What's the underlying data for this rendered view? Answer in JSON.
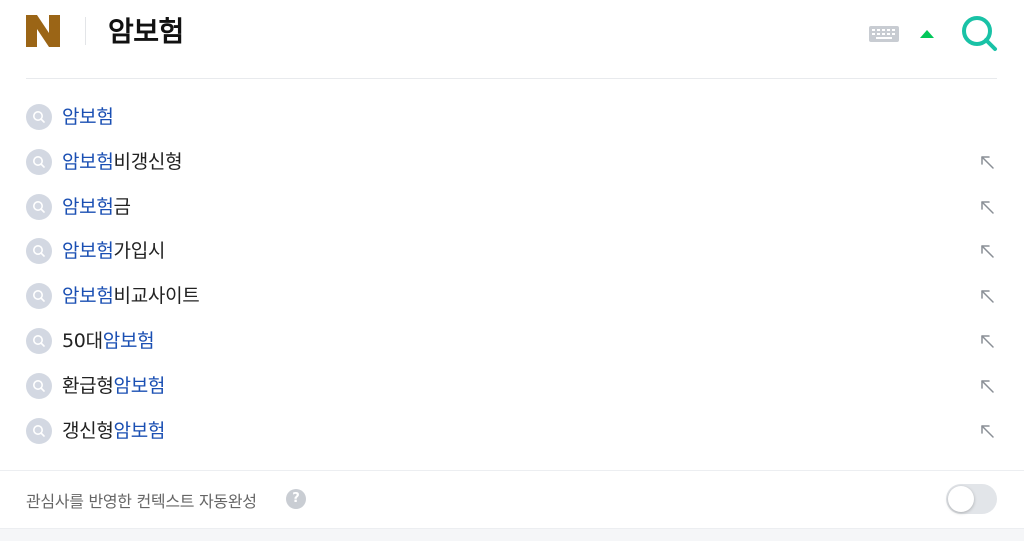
{
  "header": {
    "logo_letter": "N",
    "query": "암보험"
  },
  "suggestions": [
    {
      "prefix": "",
      "highlight": "암보험",
      "suffix": "",
      "has_fill_icon": false
    },
    {
      "prefix": "",
      "highlight": "암보험",
      "suffix": "비갱신형",
      "has_fill_icon": true
    },
    {
      "prefix": "",
      "highlight": "암보험",
      "suffix": "금",
      "has_fill_icon": true
    },
    {
      "prefix": "",
      "highlight": "암보험",
      "suffix": "가입시",
      "has_fill_icon": true
    },
    {
      "prefix": "",
      "highlight": "암보험",
      "suffix": "비교사이트",
      "has_fill_icon": true
    },
    {
      "prefix": "50대",
      "highlight": "암보험",
      "suffix": "",
      "has_fill_icon": true
    },
    {
      "prefix": "환급형",
      "highlight": "암보험",
      "suffix": "",
      "has_fill_icon": true
    },
    {
      "prefix": "갱신형",
      "highlight": "암보험",
      "suffix": "",
      "has_fill_icon": true
    }
  ],
  "footer": {
    "label": "관심사를 반영한 컨텍스트 자동완성",
    "help_glyph": "?",
    "toggle_on": false
  },
  "colors": {
    "logo": "#9b6516",
    "highlight": "#1a4fb3",
    "accent_green": "#03c75a",
    "search_teal": "#19c2a6"
  },
  "icons": {
    "keyboard": "keyboard-icon",
    "collapse": "arrow-up-icon",
    "search": "search-icon",
    "suggestion": "magnifier-icon",
    "fill": "arrow-up-left-icon"
  }
}
